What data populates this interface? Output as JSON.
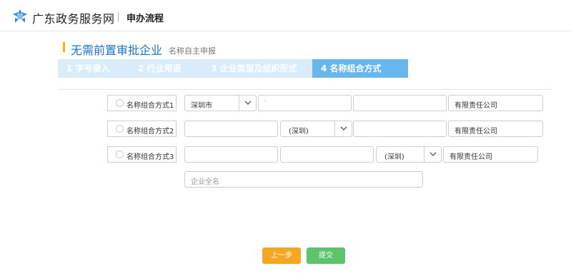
{
  "header": {
    "site_name": "广东政务服务网",
    "section_title": "申办流程"
  },
  "page": {
    "title": "无需前置审批企业",
    "subtitle": "名称自主申报"
  },
  "steps": [
    {
      "label": "1 字号录入",
      "active": false
    },
    {
      "label": "2 行业用语",
      "active": false
    },
    {
      "label": "3 企业类型及组织形式",
      "active": false
    },
    {
      "label": "4 名称组合方式",
      "active": true
    }
  ],
  "options": [
    {
      "label": "名称组合方式1",
      "city": "深圳市",
      "suffix": "有限责任公司"
    },
    {
      "label": "名称组合方式2",
      "region": "(深圳)",
      "suffix": "有限责任公司"
    },
    {
      "label": "名称组合方式3",
      "region": "(深圳)",
      "suffix": "有限责任公司"
    }
  ],
  "full_name": {
    "placeholder": "企业全名"
  },
  "buttons": {
    "prev": "上一步",
    "submit": "提交"
  },
  "colors": {
    "brand_blue": "#1a73c8",
    "step_active": "#68b6ee",
    "step_inactive": "#d8ecfa",
    "title_accent": "#f5b800",
    "prev_button": "#f5a623",
    "submit_button": "#5cc46a"
  },
  "icons": {
    "logo": "guangdong-gov-logo-icon",
    "select_arrow": "chevron-down-icon"
  }
}
